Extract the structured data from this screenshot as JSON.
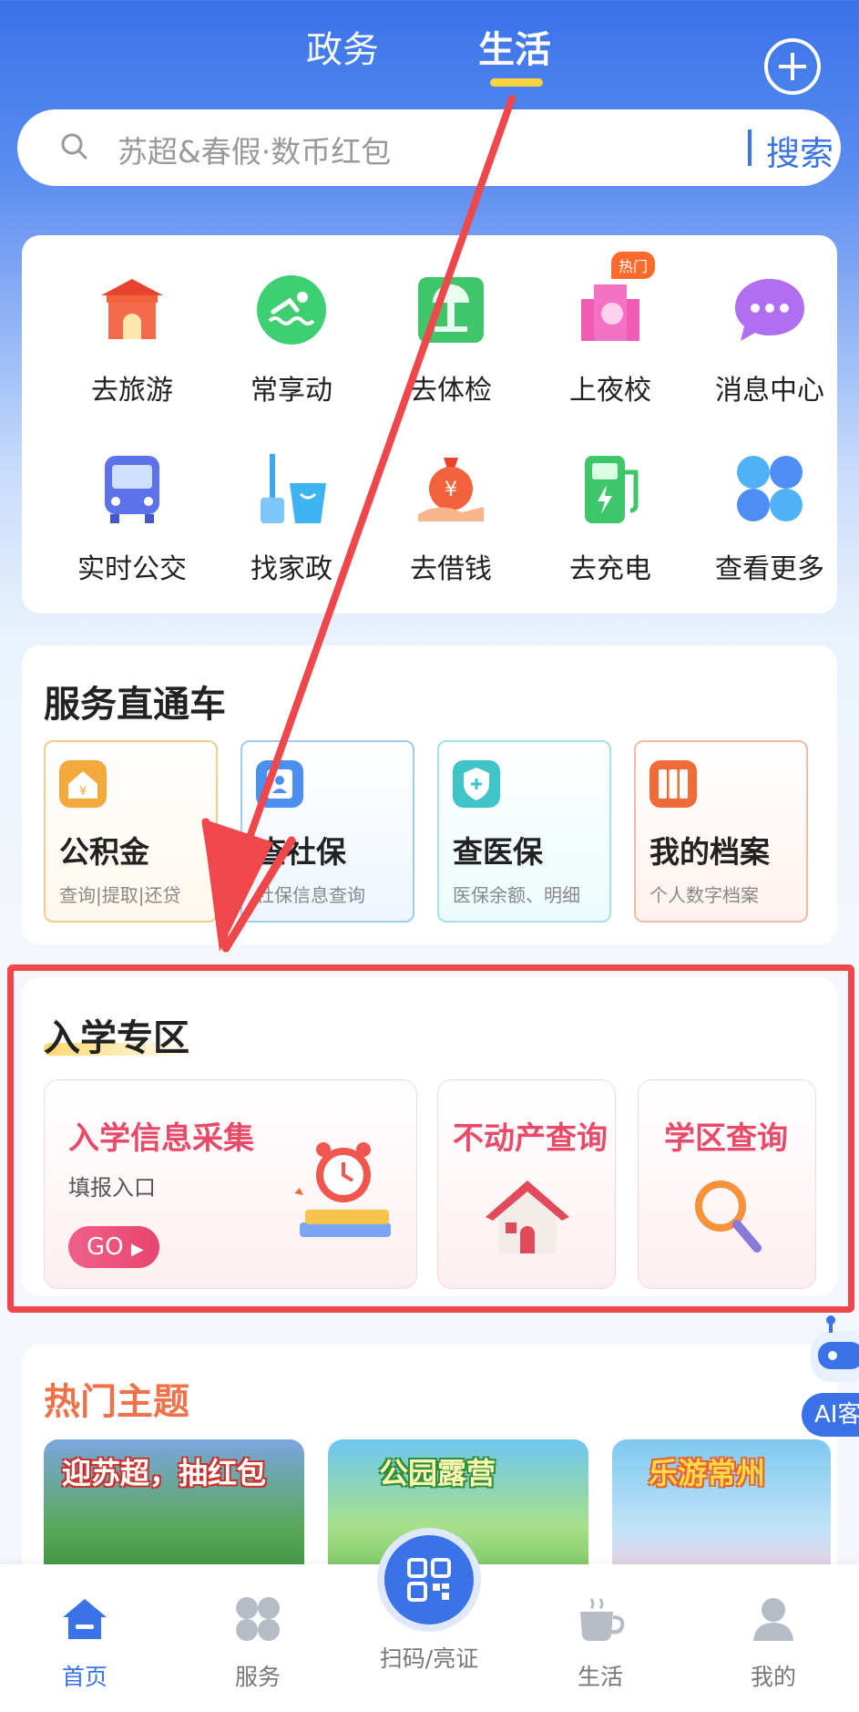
{
  "header": {
    "tabs": [
      {
        "label": "政务"
      },
      {
        "label": "生活"
      }
    ],
    "active_tab": "生活"
  },
  "search": {
    "placeholder": "苏超&春假·数币红包",
    "button": "搜索"
  },
  "quick_grid": {
    "items": [
      {
        "label": "去旅游",
        "icon": "travel-gate-icon"
      },
      {
        "label": "常享动",
        "icon": "swim-icon"
      },
      {
        "label": "去体检",
        "icon": "checkup-icon"
      },
      {
        "label": "上夜校",
        "icon": "night-school-icon",
        "badge": "热门"
      },
      {
        "label": "消息中心",
        "icon": "chat-bubble-icon"
      },
      {
        "label": "实时公交",
        "icon": "bus-icon"
      },
      {
        "label": "找家政",
        "icon": "cleaning-icon"
      },
      {
        "label": "去借钱",
        "icon": "money-bag-icon"
      },
      {
        "label": "去充电",
        "icon": "charging-station-icon"
      },
      {
        "label": "查看更多",
        "icon": "more-grid-icon"
      }
    ]
  },
  "service": {
    "title": "服务直通车",
    "tiles": [
      {
        "name": "公积金",
        "desc": "查询|提取|还贷",
        "color": "#f3a93b"
      },
      {
        "name": "查社保",
        "desc": "社保信息查询",
        "color": "#4b8ff0"
      },
      {
        "name": "查医保",
        "desc": "医保余额、明细",
        "color": "#3fc4c8"
      },
      {
        "name": "我的档案",
        "desc": "个人数字档案",
        "color": "#f06a3a"
      }
    ]
  },
  "school": {
    "title": "入学专区",
    "tiles": [
      {
        "title": "入学信息采集",
        "sub": "填报入口",
        "button": "GO"
      },
      {
        "title": "不动产查询"
      },
      {
        "title": "学区查询"
      }
    ]
  },
  "hot": {
    "title": "热门主题",
    "banners": [
      {
        "text": "迎苏超，抽红包"
      },
      {
        "text": "公园露营"
      },
      {
        "text": "乐游常州"
      }
    ]
  },
  "ai_float": {
    "label": "AI客"
  },
  "bottom_nav": {
    "items": [
      {
        "label": "首页",
        "active": true
      },
      {
        "label": "服务"
      },
      {
        "label": "扫码/亮证"
      },
      {
        "label": "生活"
      },
      {
        "label": "我的"
      }
    ]
  }
}
